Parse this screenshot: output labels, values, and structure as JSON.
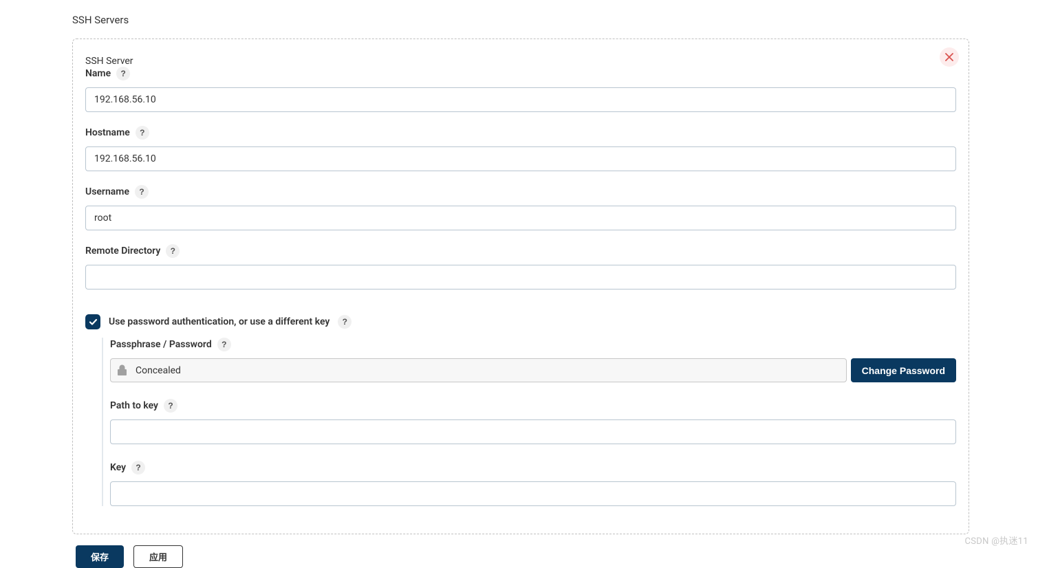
{
  "section_title": "SSH Servers",
  "panel": {
    "title": "SSH Server",
    "fields": {
      "name": {
        "label": "Name",
        "value": "192.168.56.10"
      },
      "hostname": {
        "label": "Hostname",
        "value": "192.168.56.10"
      },
      "username": {
        "label": "Username",
        "value": "root"
      },
      "remote_directory": {
        "label": "Remote Directory",
        "value": ""
      }
    },
    "auth_checkbox": {
      "label": "Use password authentication, or use a different key",
      "checked": true
    },
    "auth_section": {
      "passphrase": {
        "label": "Passphrase / Password",
        "concealed_text": "Concealed",
        "change_button": "Change Password"
      },
      "path_to_key": {
        "label": "Path to key",
        "value": ""
      },
      "key": {
        "label": "Key",
        "value": ""
      }
    }
  },
  "footer": {
    "save": "保存",
    "apply": "应用"
  },
  "watermark": "CSDN @执迷11"
}
